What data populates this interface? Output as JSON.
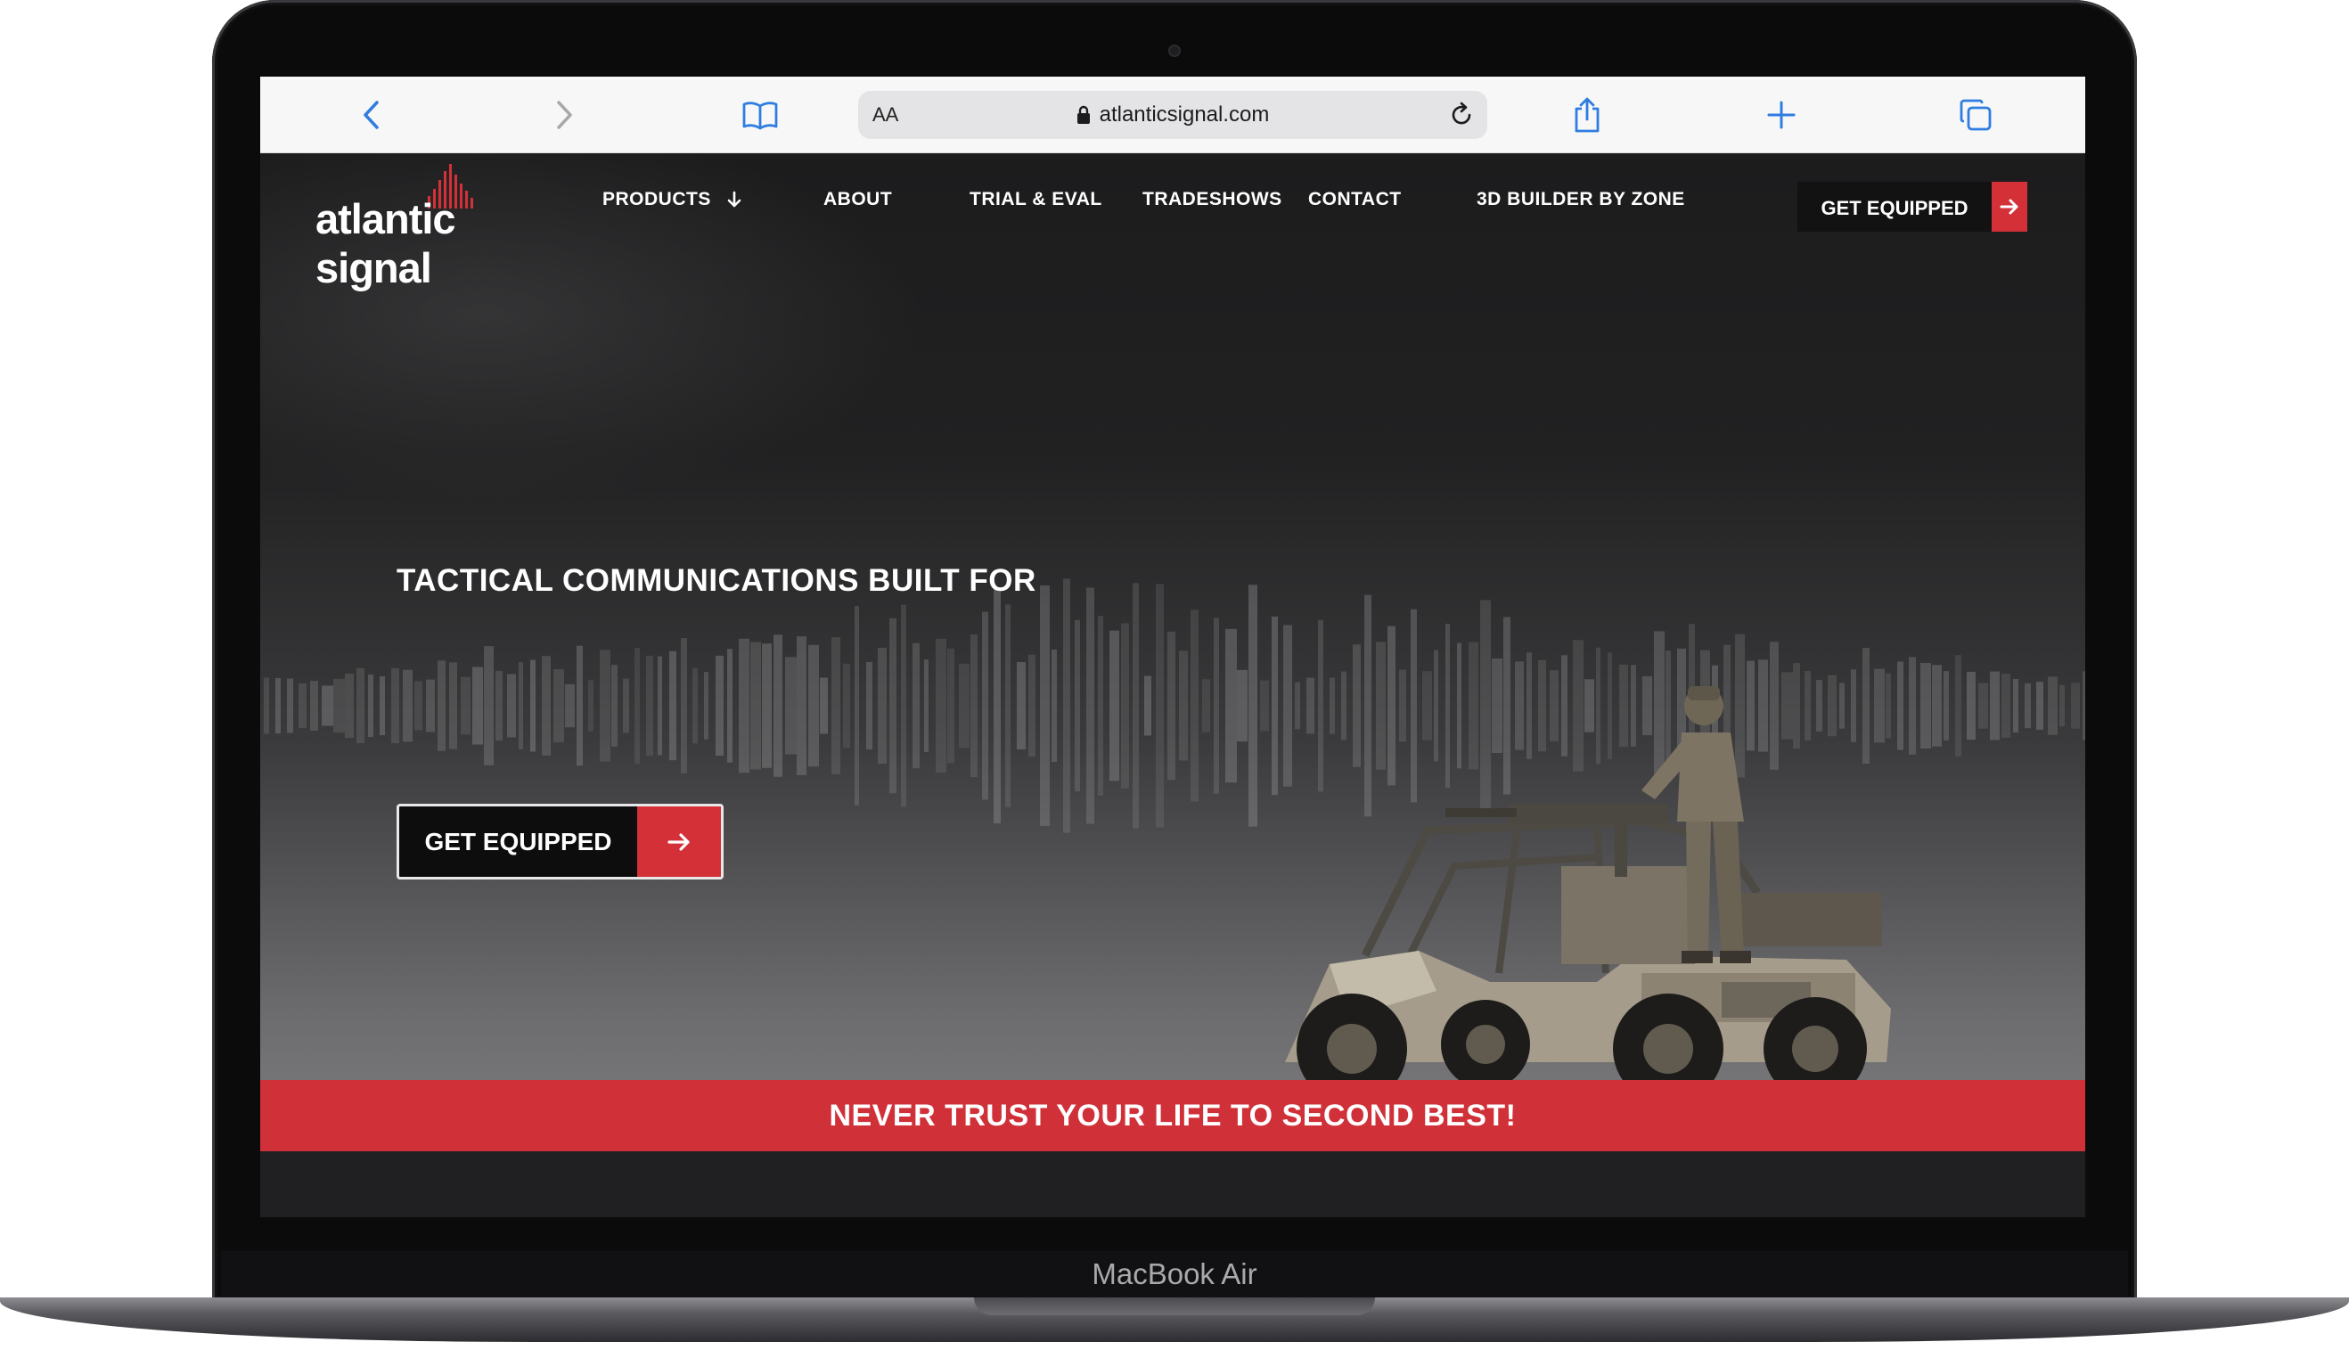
{
  "device": {
    "label": "MacBook Air"
  },
  "browser": {
    "reader_label": "AA",
    "url": "atlanticsignal.com",
    "icons": [
      "back-icon",
      "forward-icon",
      "bookmarks-icon",
      "lock-icon",
      "reload-icon",
      "share-icon",
      "new-tab-icon",
      "tabs-icon"
    ]
  },
  "site": {
    "logo": "atlantic signal",
    "nav": {
      "items": [
        "PRODUCTS",
        "ABOUT",
        "TRIAL & EVAL",
        "TRADESHOWS",
        "CONTACT",
        "3D BUILDER BY ZONE"
      ],
      "cta": "GET EQUIPPED"
    },
    "hero": {
      "title": "TACTICAL COMMUNICATIONS BUILT FOR",
      "cta": "GET EQUIPPED"
    },
    "banner": "NEVER TRUST YOUR LIFE TO SECOND BEST!"
  },
  "colors": {
    "accent_red": "#d33038",
    "nav_background": "#1c1c1d",
    "toolbar_background": "#f7f7f7",
    "link_blue": "#2f7de1"
  }
}
